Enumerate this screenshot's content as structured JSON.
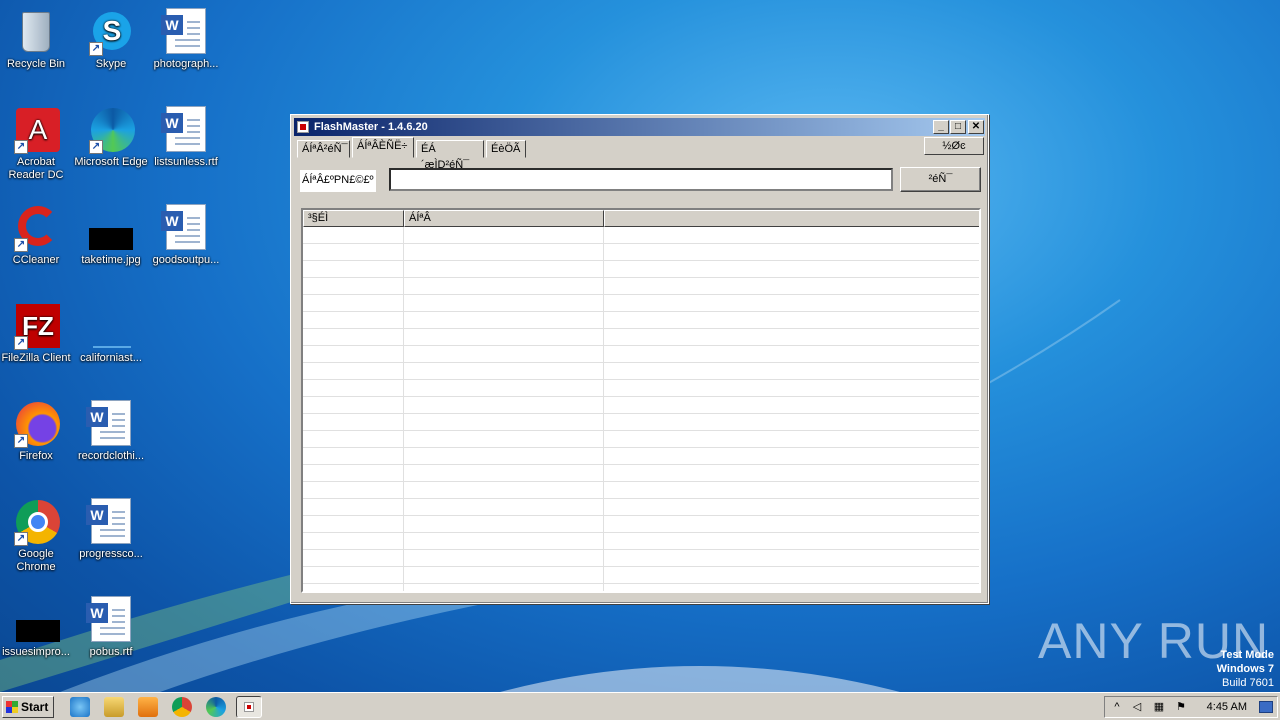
{
  "desktop": {
    "icons": [
      {
        "label": "Recycle Bin",
        "icon": "recycle-bin-icon"
      },
      {
        "label": "Skype",
        "icon": "skype-icon"
      },
      {
        "label": "photograph...",
        "icon": "word-doc-icon"
      },
      {
        "label": "Acrobat Reader DC",
        "icon": "acrobat-icon"
      },
      {
        "label": "Microsoft Edge",
        "icon": "edge-icon"
      },
      {
        "label": "listsunless.rtf",
        "icon": "word-doc-icon"
      },
      {
        "label": "CCleaner",
        "icon": "ccleaner-icon"
      },
      {
        "label": "taketime.jpg",
        "icon": "image-file-icon"
      },
      {
        "label": "goodsoutpu...",
        "icon": "word-doc-icon"
      },
      {
        "label": "FileZilla Client",
        "icon": "filezilla-icon"
      },
      {
        "label": "californiast...",
        "icon": "file-icon"
      },
      {
        "label": "Firefox",
        "icon": "firefox-icon"
      },
      {
        "label": "recordclothi...",
        "icon": "word-doc-icon"
      },
      {
        "label": "Google Chrome",
        "icon": "chrome-icon"
      },
      {
        "label": "progressco...",
        "icon": "word-doc-icon"
      },
      {
        "label": "issuesimpro...",
        "icon": "image-file-icon"
      },
      {
        "label": "pobus.rtf",
        "icon": "word-doc-icon"
      }
    ]
  },
  "window": {
    "title": "FlashMaster - 1.4.6.20",
    "tabs": [
      "ÁÍªÂ²éÑ¯",
      "ÁÍªÂÈÑË÷",
      "ÉÁ´æÌD²éÑ¯",
      "ÉèÖÃ"
    ],
    "selected_tab": 1,
    "right_button": "½Øͼ",
    "search_label": "ÁÍªÂ£ºPN£©£º",
    "search_value": "",
    "search_button": "²éÑ¯",
    "columns": [
      "³§ÉÌ",
      "ÁÍªÂ",
      ""
    ],
    "rows_visible": 21
  },
  "taskbar": {
    "start_label": "Start",
    "clock": "4:45 AM"
  },
  "watermark": {
    "text": "ANY RUN"
  },
  "testmode": {
    "line1": "Test Mode",
    "line2": "Windows 7",
    "line3": "Build 7601"
  },
  "colors": {
    "titlebar_start": "#0a246a",
    "titlebar_end": "#a6caf0",
    "window_face": "#d4d0c8"
  }
}
